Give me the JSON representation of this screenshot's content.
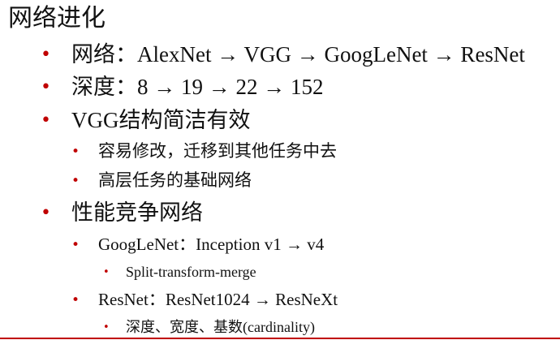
{
  "slide": {
    "title": "网络进化",
    "bullet_glyph": "•",
    "items": [
      {
        "text": "网络：AlexNet → VGG → GoogLeNet → ResNet"
      },
      {
        "text": "深度：8 → 19 → 22 → 152"
      },
      {
        "text": "VGG结构简洁有效"
      },
      {
        "text": "容易修改，迁移到其他任务中去"
      },
      {
        "text": "高层任务的基础网络"
      },
      {
        "text": "性能竞争网络"
      },
      {
        "text": "GoogLeNet：Inception v1 → v4"
      },
      {
        "text": "Split-transform-merge"
      },
      {
        "text": "ResNet：ResNet1024 → ResNeXt"
      },
      {
        "text": "深度、宽度、基数(cardinality)"
      }
    ]
  },
  "colors": {
    "bullet": "#c00000",
    "text": "#111111",
    "rule": "#c00000"
  }
}
